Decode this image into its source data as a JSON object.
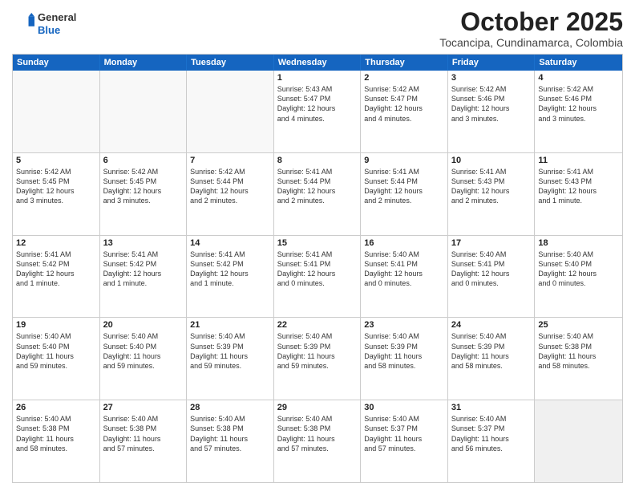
{
  "header": {
    "logo_general": "General",
    "logo_blue": "Blue",
    "month_title": "October 2025",
    "location": "Tocancipa, Cundinamarca, Colombia"
  },
  "weekdays": [
    "Sunday",
    "Monday",
    "Tuesday",
    "Wednesday",
    "Thursday",
    "Friday",
    "Saturday"
  ],
  "rows": [
    [
      {
        "day": "",
        "text": "",
        "empty": true
      },
      {
        "day": "",
        "text": "",
        "empty": true
      },
      {
        "day": "",
        "text": "",
        "empty": true
      },
      {
        "day": "1",
        "text": "Sunrise: 5:43 AM\nSunset: 5:47 PM\nDaylight: 12 hours\nand 4 minutes."
      },
      {
        "day": "2",
        "text": "Sunrise: 5:42 AM\nSunset: 5:47 PM\nDaylight: 12 hours\nand 4 minutes."
      },
      {
        "day": "3",
        "text": "Sunrise: 5:42 AM\nSunset: 5:46 PM\nDaylight: 12 hours\nand 3 minutes."
      },
      {
        "day": "4",
        "text": "Sunrise: 5:42 AM\nSunset: 5:46 PM\nDaylight: 12 hours\nand 3 minutes."
      }
    ],
    [
      {
        "day": "5",
        "text": "Sunrise: 5:42 AM\nSunset: 5:45 PM\nDaylight: 12 hours\nand 3 minutes."
      },
      {
        "day": "6",
        "text": "Sunrise: 5:42 AM\nSunset: 5:45 PM\nDaylight: 12 hours\nand 3 minutes."
      },
      {
        "day": "7",
        "text": "Sunrise: 5:42 AM\nSunset: 5:44 PM\nDaylight: 12 hours\nand 2 minutes."
      },
      {
        "day": "8",
        "text": "Sunrise: 5:41 AM\nSunset: 5:44 PM\nDaylight: 12 hours\nand 2 minutes."
      },
      {
        "day": "9",
        "text": "Sunrise: 5:41 AM\nSunset: 5:44 PM\nDaylight: 12 hours\nand 2 minutes."
      },
      {
        "day": "10",
        "text": "Sunrise: 5:41 AM\nSunset: 5:43 PM\nDaylight: 12 hours\nand 2 minutes."
      },
      {
        "day": "11",
        "text": "Sunrise: 5:41 AM\nSunset: 5:43 PM\nDaylight: 12 hours\nand 1 minute."
      }
    ],
    [
      {
        "day": "12",
        "text": "Sunrise: 5:41 AM\nSunset: 5:42 PM\nDaylight: 12 hours\nand 1 minute."
      },
      {
        "day": "13",
        "text": "Sunrise: 5:41 AM\nSunset: 5:42 PM\nDaylight: 12 hours\nand 1 minute."
      },
      {
        "day": "14",
        "text": "Sunrise: 5:41 AM\nSunset: 5:42 PM\nDaylight: 12 hours\nand 1 minute."
      },
      {
        "day": "15",
        "text": "Sunrise: 5:41 AM\nSunset: 5:41 PM\nDaylight: 12 hours\nand 0 minutes."
      },
      {
        "day": "16",
        "text": "Sunrise: 5:40 AM\nSunset: 5:41 PM\nDaylight: 12 hours\nand 0 minutes."
      },
      {
        "day": "17",
        "text": "Sunrise: 5:40 AM\nSunset: 5:41 PM\nDaylight: 12 hours\nand 0 minutes."
      },
      {
        "day": "18",
        "text": "Sunrise: 5:40 AM\nSunset: 5:40 PM\nDaylight: 12 hours\nand 0 minutes."
      }
    ],
    [
      {
        "day": "19",
        "text": "Sunrise: 5:40 AM\nSunset: 5:40 PM\nDaylight: 11 hours\nand 59 minutes."
      },
      {
        "day": "20",
        "text": "Sunrise: 5:40 AM\nSunset: 5:40 PM\nDaylight: 11 hours\nand 59 minutes."
      },
      {
        "day": "21",
        "text": "Sunrise: 5:40 AM\nSunset: 5:39 PM\nDaylight: 11 hours\nand 59 minutes."
      },
      {
        "day": "22",
        "text": "Sunrise: 5:40 AM\nSunset: 5:39 PM\nDaylight: 11 hours\nand 59 minutes."
      },
      {
        "day": "23",
        "text": "Sunrise: 5:40 AM\nSunset: 5:39 PM\nDaylight: 11 hours\nand 58 minutes."
      },
      {
        "day": "24",
        "text": "Sunrise: 5:40 AM\nSunset: 5:39 PM\nDaylight: 11 hours\nand 58 minutes."
      },
      {
        "day": "25",
        "text": "Sunrise: 5:40 AM\nSunset: 5:38 PM\nDaylight: 11 hours\nand 58 minutes."
      }
    ],
    [
      {
        "day": "26",
        "text": "Sunrise: 5:40 AM\nSunset: 5:38 PM\nDaylight: 11 hours\nand 58 minutes."
      },
      {
        "day": "27",
        "text": "Sunrise: 5:40 AM\nSunset: 5:38 PM\nDaylight: 11 hours\nand 57 minutes."
      },
      {
        "day": "28",
        "text": "Sunrise: 5:40 AM\nSunset: 5:38 PM\nDaylight: 11 hours\nand 57 minutes."
      },
      {
        "day": "29",
        "text": "Sunrise: 5:40 AM\nSunset: 5:38 PM\nDaylight: 11 hours\nand 57 minutes."
      },
      {
        "day": "30",
        "text": "Sunrise: 5:40 AM\nSunset: 5:37 PM\nDaylight: 11 hours\nand 57 minutes."
      },
      {
        "day": "31",
        "text": "Sunrise: 5:40 AM\nSunset: 5:37 PM\nDaylight: 11 hours\nand 56 minutes."
      },
      {
        "day": "",
        "text": "",
        "empty": true,
        "shaded": true
      }
    ]
  ]
}
